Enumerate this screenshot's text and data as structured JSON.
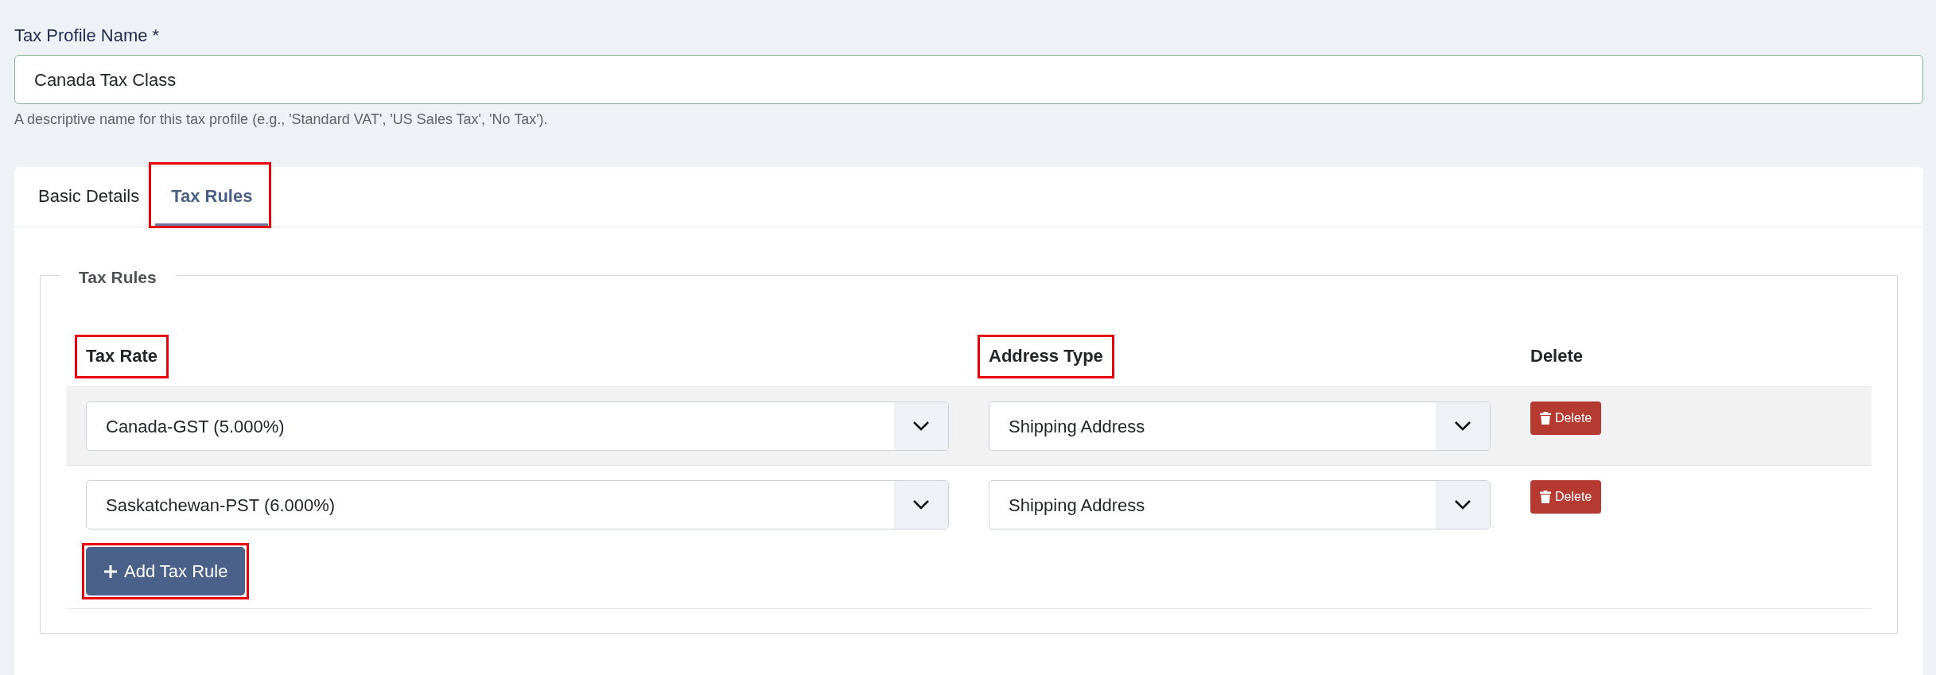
{
  "field": {
    "label": "Tax Profile Name *",
    "value": "Canada Tax Class",
    "help": "A descriptive name for this tax profile (e.g., 'Standard VAT', 'US Sales Tax', 'No Tax')."
  },
  "tabs": [
    {
      "label": "Basic Details",
      "selected": false,
      "highlighted": false
    },
    {
      "label": "Tax Rules",
      "selected": true,
      "highlighted": true
    }
  ],
  "fieldset": {
    "legend": "Tax Rules"
  },
  "table": {
    "columns": [
      {
        "label": "Tax Rate",
        "highlighted": true
      },
      {
        "label": "Address Type",
        "highlighted": true
      },
      {
        "label": "Delete",
        "highlighted": false
      }
    ],
    "rows": [
      {
        "tax_rate": "Canada-GST (5.000%)",
        "address_type": "Shipping Address",
        "delete": "Delete"
      },
      {
        "tax_rate": "Saskatchewan-PST (6.000%)",
        "address_type": "Shipping Address",
        "delete": "Delete"
      }
    ]
  },
  "add_button": {
    "label": "Add Tax Rule",
    "highlighted": true
  }
}
